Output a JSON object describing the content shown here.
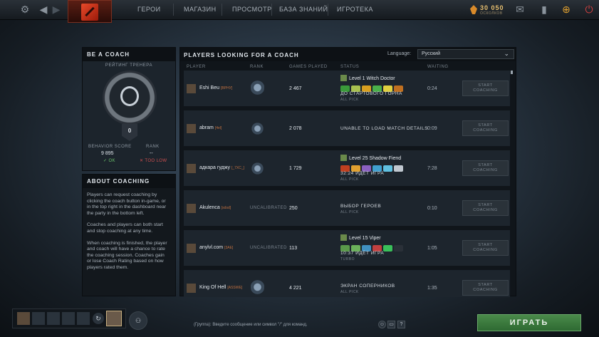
{
  "topbar": {
    "nav": [
      "ГЕРОИ",
      "МАГАЗИН",
      "ПРОСМОТР",
      "БАЗА ЗНАНИЙ",
      "ИГРОТЕКА"
    ],
    "shards_value": "30 050",
    "shards_label": "ОСКОЛКОВ"
  },
  "coach": {
    "title": "BE A COACH",
    "rating_label": "РЕЙТИНГ ТРЕНЕРА",
    "rating_value": "0",
    "behavior_label": "BEHAVIOR SCORE",
    "behavior_value": "9 895",
    "behavior_status": "✓ OK",
    "rank_label": "RANK",
    "rank_value": "--",
    "rank_status": "✕ TOO LOW"
  },
  "about": {
    "title": "ABOUT COACHING",
    "p1": "Players can request coaching by clicking the coach button in-game, or in the top right in the dashboard near the party in the bottom left.",
    "p2": "Coaches and players can both start and stop coaching at any time.",
    "p3": "When coaching is finished, the player and coach will have a chance to rate the coaching session. Coaches gain or lose Coach Rating based on how players rated them."
  },
  "main": {
    "title": "PLAYERS LOOKING FOR A COACH",
    "language_label": "Language:",
    "language_value": "Русский",
    "columns": {
      "player": "PLAYER",
      "rank": "RANK",
      "games": "GAMES PLAYED",
      "status": "STATUS",
      "waiting": "WAITING"
    },
    "button_label": "START\nCOACHING"
  },
  "rows": [
    {
      "name": "Eshi Beu",
      "tag": "[ВРНУ]",
      "rank": "icon",
      "games": "2 467",
      "hero": "Level 1 Witch Doctor",
      "status": "ДО СТАРТОВОГО ГОРНА",
      "mode": "ALL PICK",
      "waiting": "0:24",
      "item_colors": [
        "#3a9a3a",
        "#a8c050",
        "#d8a020",
        "#4ab04a",
        "#e0d040",
        "#c07020"
      ]
    },
    {
      "name": "abram",
      "tag": "[4el]",
      "rank": "icon",
      "games": "2 078",
      "hero": "",
      "status": "UNABLE TO LOAD MATCH DETAILS",
      "mode": "",
      "waiting": "0:09",
      "item_colors": []
    },
    {
      "name": "адкара гуджу",
      "tag": "[_7XC_]",
      "rank": "icon",
      "games": "1 729",
      "hero": "Level 25 Shadow Fiend",
      "status": "32:24 ИДЁТ ИГРА",
      "mode": "ALL PICK",
      "waiting": "7:28",
      "item_colors": [
        "#c04020",
        "#e0a030",
        "#8a60c0",
        "#40a0d0",
        "#60c0e0",
        "#c0c8d0"
      ]
    },
    {
      "name": "Akulenca",
      "tag": "[sdsd]",
      "rank": "UNCALIBRATED",
      "games": "250",
      "hero": "",
      "status": "ВЫБОР ГЕРОЕВ",
      "mode": "ALL PICK",
      "waiting": "0:10",
      "item_colors": []
    },
    {
      "name": "anylvl.com",
      "tag": "[3AE]",
      "rank": "UNCALIBRATED",
      "games": "113",
      "hero": "Level 15 Viper",
      "status": "10:37 ИДЁТ ИГРА",
      "mode": "TURBO",
      "waiting": "1:05",
      "item_colors": [
        "#5a9a4a",
        "#6ab05a",
        "#4090c0",
        "#c04040",
        "#3ac05a",
        "#2a3038"
      ]
    },
    {
      "name": "King Of Hell",
      "tag": "[ASSWE]",
      "rank": "icon",
      "games": "4 221",
      "hero": "",
      "status": "ЭКРАН СОПЕРНИКОВ",
      "mode": "ALL PICK",
      "waiting": "1:35",
      "item_colors": []
    }
  ],
  "chat": {
    "placeholder": "(Группа): Введите сообщение или символ \"/\" для команд."
  },
  "play_label": "ИГРАТЬ"
}
